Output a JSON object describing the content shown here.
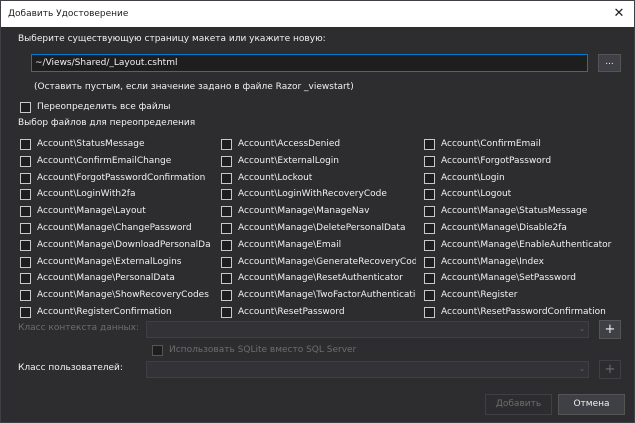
{
  "window": {
    "title": "Добавить Удостоверение",
    "close_glyph": "✕"
  },
  "intro_label": "Выберите существующую страницу макета или укажите новую:",
  "layout_path": "~/Views/Shared/_Layout.cshtml",
  "browse_label": "...",
  "hint": "(Оставить пустым, если значение задано в файле Razor _viewstart)",
  "override_all_label": "Переопределить все файлы",
  "files_section_label": "Выбор файлов для переопределения",
  "files": [
    [
      "Account\\StatusMessage",
      "Account\\AccessDenied",
      "Account\\ConfirmEmail"
    ],
    [
      "Account\\ConfirmEmailChange",
      "Account\\ExternalLogin",
      "Account\\ForgotPassword"
    ],
    [
      "Account\\ForgotPasswordConfirmation",
      "Account\\Lockout",
      "Account\\Login"
    ],
    [
      "Account\\LoginWith2fa",
      "Account\\LoginWithRecoveryCode",
      "Account\\Logout"
    ],
    [
      "Account\\Manage\\Layout",
      "Account\\Manage\\ManageNav",
      "Account\\Manage\\StatusMessage"
    ],
    [
      "Account\\Manage\\ChangePassword",
      "Account\\Manage\\DeletePersonalData",
      "Account\\Manage\\Disable2fa"
    ],
    [
      "Account\\Manage\\DownloadPersonalData",
      "Account\\Manage\\Email",
      "Account\\Manage\\EnableAuthenticator"
    ],
    [
      "Account\\Manage\\ExternalLogins",
      "Account\\Manage\\GenerateRecoveryCodes",
      "Account\\Manage\\Index"
    ],
    [
      "Account\\Manage\\PersonalData",
      "Account\\Manage\\ResetAuthenticator",
      "Account\\Manage\\SetPassword"
    ],
    [
      "Account\\Manage\\ShowRecoveryCodes",
      "Account\\Manage\\TwoFactorAuthentication",
      "Account\\Register"
    ],
    [
      "Account\\RegisterConfirmation",
      "Account\\ResetPassword",
      "Account\\ResetPasswordConfirmation"
    ]
  ],
  "data_context_label": "Класс контекста данных:",
  "sqlite_label": "Использовать SQLite вместо SQL Server",
  "user_class_label": "Класс пользователей:",
  "plus_glyph": "+",
  "combo_arrow": "⌄",
  "add_button": "Добавить",
  "cancel_button": "Отмена"
}
